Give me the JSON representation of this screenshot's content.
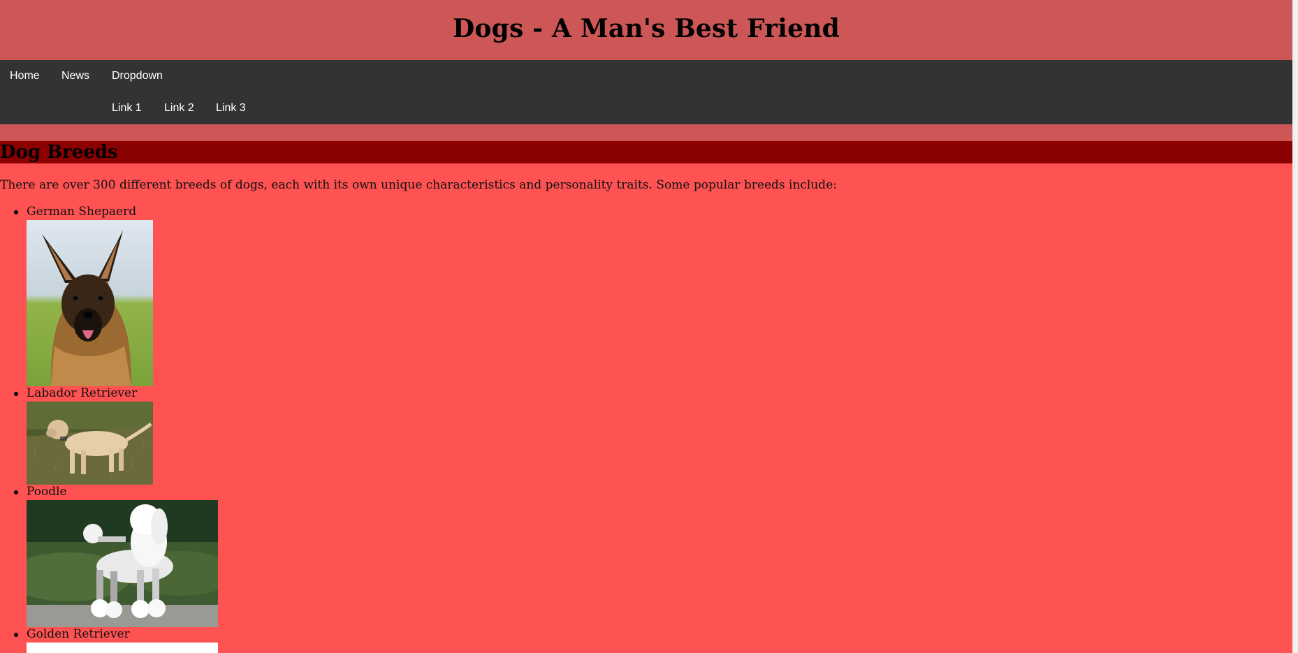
{
  "header": {
    "title": "Dogs - A Man's Best Friend"
  },
  "nav": {
    "items": [
      "Home",
      "News",
      "Dropdown"
    ],
    "dropdown_items": [
      "Link 1",
      "Link 2",
      "Link 3"
    ]
  },
  "main": {
    "heading": "Dog Breeds",
    "intro": "There are over 300 different breeds of dogs, each with its own unique characteristics and personality traits. Some popular breeds include:",
    "breeds": [
      {
        "name": "German Shepaerd"
      },
      {
        "name": "Labador Retriever"
      },
      {
        "name": "Poodle"
      },
      {
        "name": "Golden Retriever"
      }
    ]
  },
  "colors": {
    "header_bg": "#cd5757",
    "nav_bg": "#333333",
    "page_bg": "#ff5252",
    "heading_bg": "#8b0000"
  }
}
